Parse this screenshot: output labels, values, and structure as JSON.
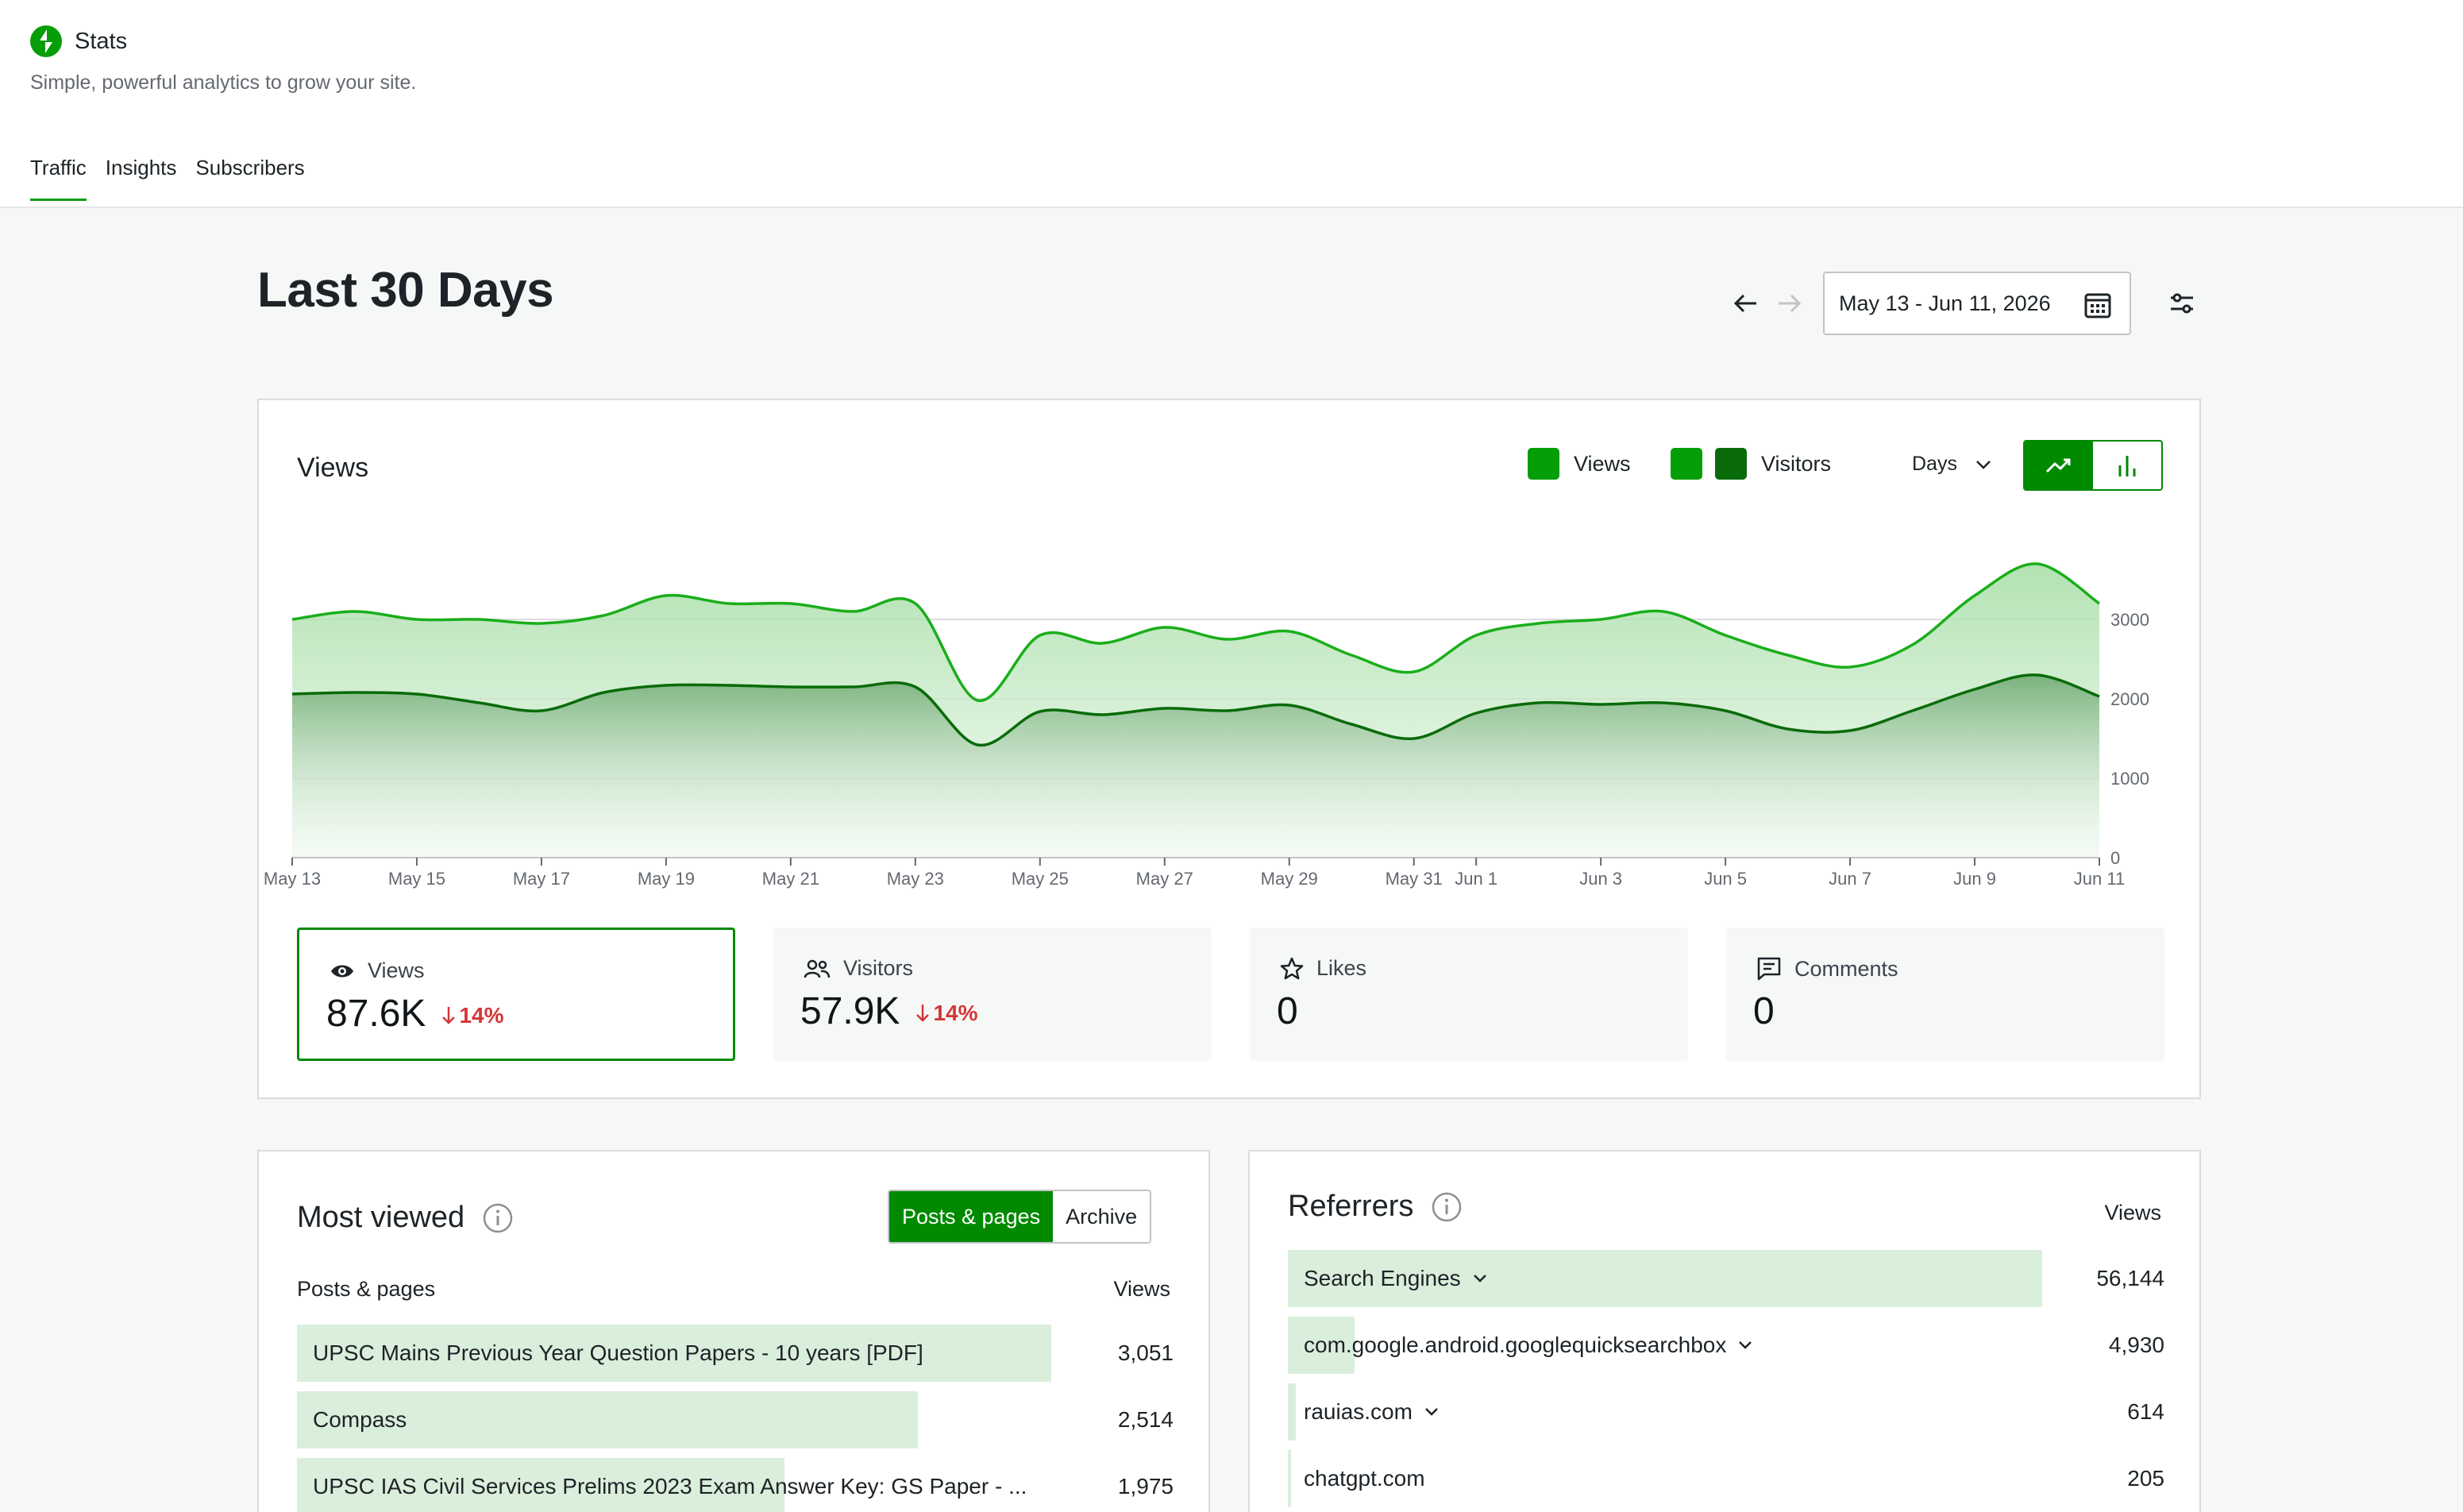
{
  "app": {
    "title": "Stats",
    "subtitle": "Simple, powerful analytics to grow your site.",
    "brand_color": "#069e08"
  },
  "tabs": [
    {
      "label": "Traffic",
      "active": true
    },
    {
      "label": "Insights",
      "active": false
    },
    {
      "label": "Subscribers",
      "active": false
    }
  ],
  "period": {
    "title": "Last 30 Days",
    "date_range": "May 13 - Jun 11, 2026",
    "prev_icon": "arrow-left-icon",
    "next_icon": "arrow-right-icon",
    "next_enabled": false
  },
  "views_chart": {
    "title": "Views",
    "legend": {
      "views": "Views",
      "visitors": "Visitors"
    },
    "interval": "Days",
    "chart_mode": "line",
    "colors": {
      "views": "#1aae1a",
      "visitors": "#0a6b0a",
      "views_fill": "#c9ebc9",
      "visitors_fill": "#6fa873"
    }
  },
  "chart_data": {
    "type": "area",
    "title": "Views",
    "xlabel": "",
    "ylabel": "",
    "ylim": [
      0,
      4000
    ],
    "yticks": [
      0,
      1000,
      2000,
      3000
    ],
    "grid": true,
    "x": [
      "May 13",
      "May 14",
      "May 15",
      "May 16",
      "May 17",
      "May 18",
      "May 19",
      "May 20",
      "May 21",
      "May 22",
      "May 23",
      "May 24",
      "May 25",
      "May 26",
      "May 27",
      "May 28",
      "May 29",
      "May 30",
      "May 31",
      "Jun 1",
      "Jun 2",
      "Jun 3",
      "Jun 4",
      "Jun 5",
      "Jun 6",
      "Jun 7",
      "Jun 8",
      "Jun 9",
      "Jun 10",
      "Jun 11"
    ],
    "xtick_labels": [
      "May 13",
      "May 15",
      "May 17",
      "May 19",
      "May 21",
      "May 23",
      "May 25",
      "May 27",
      "May 29",
      "May 31",
      "Jun 1",
      "Jun 3",
      "Jun 5",
      "Jun 7",
      "Jun 9",
      "Jun 11"
    ],
    "series": [
      {
        "name": "Views",
        "values": [
          3000,
          3100,
          3000,
          3000,
          2950,
          3050,
          3300,
          3200,
          3200,
          3100,
          3200,
          1980,
          2800,
          2700,
          2900,
          2750,
          2850,
          2550,
          2340,
          2800,
          2950,
          3000,
          3100,
          2800,
          2550,
          2400,
          2680,
          3300,
          3700,
          3200
        ]
      },
      {
        "name": "Visitors",
        "values": [
          2060,
          2080,
          2060,
          1950,
          1850,
          2080,
          2170,
          2170,
          2150,
          2150,
          2150,
          1420,
          1840,
          1800,
          1880,
          1850,
          1920,
          1680,
          1500,
          1820,
          1950,
          1930,
          1950,
          1850,
          1620,
          1600,
          1850,
          2120,
          2300,
          2030
        ]
      }
    ]
  },
  "stats": [
    {
      "label": "Views",
      "icon": "eye-icon",
      "value": "87.6K",
      "delta": "14%",
      "selected": true
    },
    {
      "label": "Visitors",
      "icon": "people-icon",
      "value": "57.9K",
      "delta": "14%",
      "selected": false
    },
    {
      "label": "Likes",
      "icon": "star-icon",
      "value": "0",
      "delta": "",
      "selected": false
    },
    {
      "label": "Comments",
      "icon": "comment-icon",
      "value": "0",
      "delta": "",
      "selected": false
    }
  ],
  "most_viewed": {
    "title": "Most viewed",
    "toggle": [
      "Posts & pages",
      "Archive"
    ],
    "col_label": "Posts & pages",
    "col_value": "Views",
    "rows": [
      {
        "label": "UPSC Mains Previous Year Question Papers - 10 years [PDF]",
        "value": "3,051",
        "share": 1.0
      },
      {
        "label": "Compass",
        "value": "2,514",
        "share": 0.824
      },
      {
        "label": "UPSC IAS Civil Services Prelims 2023 Exam Answer Key: GS Paper - ...",
        "value": "1,975",
        "share": 0.647
      }
    ]
  },
  "referrers": {
    "title": "Referrers",
    "col_value": "Views",
    "rows": [
      {
        "label": "Search Engines",
        "value": "56,144",
        "share": 1.0,
        "expandable": true
      },
      {
        "label": "com.google.android.googlequicksearchbox",
        "value": "4,930",
        "share": 0.088,
        "expandable": true
      },
      {
        "label": "rauias.com",
        "value": "614",
        "share": 0.011,
        "expandable": true
      },
      {
        "label": "chatgpt.com",
        "value": "205",
        "share": 0.004,
        "expandable": false
      }
    ]
  }
}
